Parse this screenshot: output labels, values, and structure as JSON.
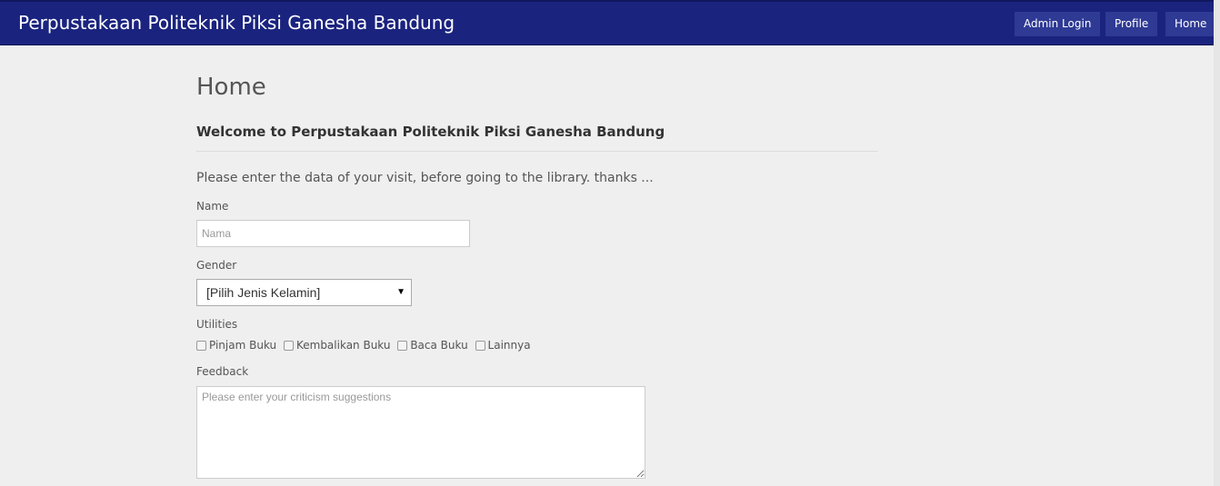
{
  "navbar": {
    "brand": "Perpustakaan Politeknik Piksi Ganesha Bandung",
    "buttons": [
      "Admin Login",
      "Profile",
      "Home"
    ]
  },
  "page": {
    "title": "Home",
    "welcome": "Welcome to Perpustakaan Politeknik Piksi Ganesha Bandung",
    "intro": "Please enter the data of your visit, before going to the library. thanks ..."
  },
  "form": {
    "name_label": "Name",
    "name_placeholder": "Nama",
    "gender_label": "Gender",
    "gender_selected": "[Pilih Jenis Kelamin]",
    "utilities_label": "Utilities",
    "utilities": [
      "Pinjam Buku",
      "Kembalikan Buku",
      "Baca Buku",
      "Lainnya"
    ],
    "feedback_label": "Feedback",
    "feedback_placeholder": "Please enter your criticism suggestions"
  },
  "colors": {
    "navbar_bg": "#1a237e",
    "nav_button_bg": "#2e3a94",
    "page_bg": "#efefef"
  },
  "icons": {
    "select_arrow": "chevron-down-icon"
  }
}
